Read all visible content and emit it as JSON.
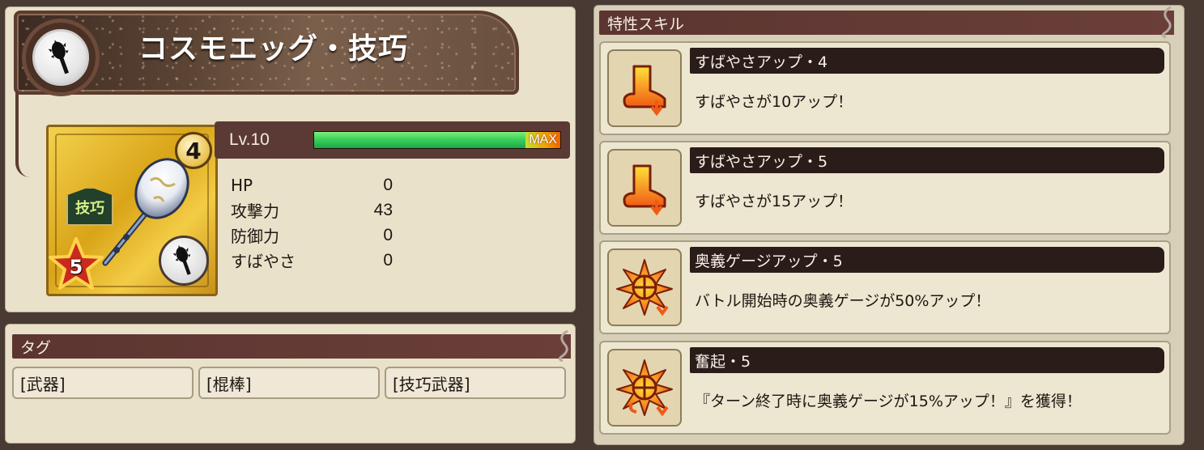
{
  "item": {
    "name": "コスモエッグ・技巧",
    "rarity_number": "4",
    "type_tag": "技巧",
    "star_level": "5",
    "level_label": "Lv.10",
    "level_progress": 1.0,
    "max_label": "MAX"
  },
  "stats": [
    {
      "label": "HP",
      "value": "0"
    },
    {
      "label": "攻撃力",
      "value": "43"
    },
    {
      "label": "防御力",
      "value": "0"
    },
    {
      "label": "すばやさ",
      "value": "0"
    }
  ],
  "tags": {
    "header": "タグ",
    "items": [
      "[武器]",
      "[棍棒]",
      "[技巧武器]"
    ]
  },
  "skills": {
    "header": "特性スキル",
    "items": [
      {
        "name": "すばやさアップ・4",
        "desc": "すばやさが10アップ！",
        "icon": "boot-icon"
      },
      {
        "name": "すばやさアップ・5",
        "desc": "すばやさが15アップ！",
        "icon": "boot-icon"
      },
      {
        "name": "奥義ゲージアップ・5",
        "desc": "バトル開始時の奥義ゲージが50%アップ！",
        "icon": "burst-gauge-icon"
      },
      {
        "name": "奮起・5",
        "desc": "『ターン終了時に奥義ゲージが15%アップ！』を獲得！",
        "icon": "burst-rise-icon"
      }
    ]
  },
  "colors": {
    "panel_bg": "#e9e1c9",
    "header_bar": "#5c3530",
    "skill_name_bar": "#2a1c18",
    "gauge_green": "#3bd25a",
    "card_gold": "#d9a418"
  }
}
